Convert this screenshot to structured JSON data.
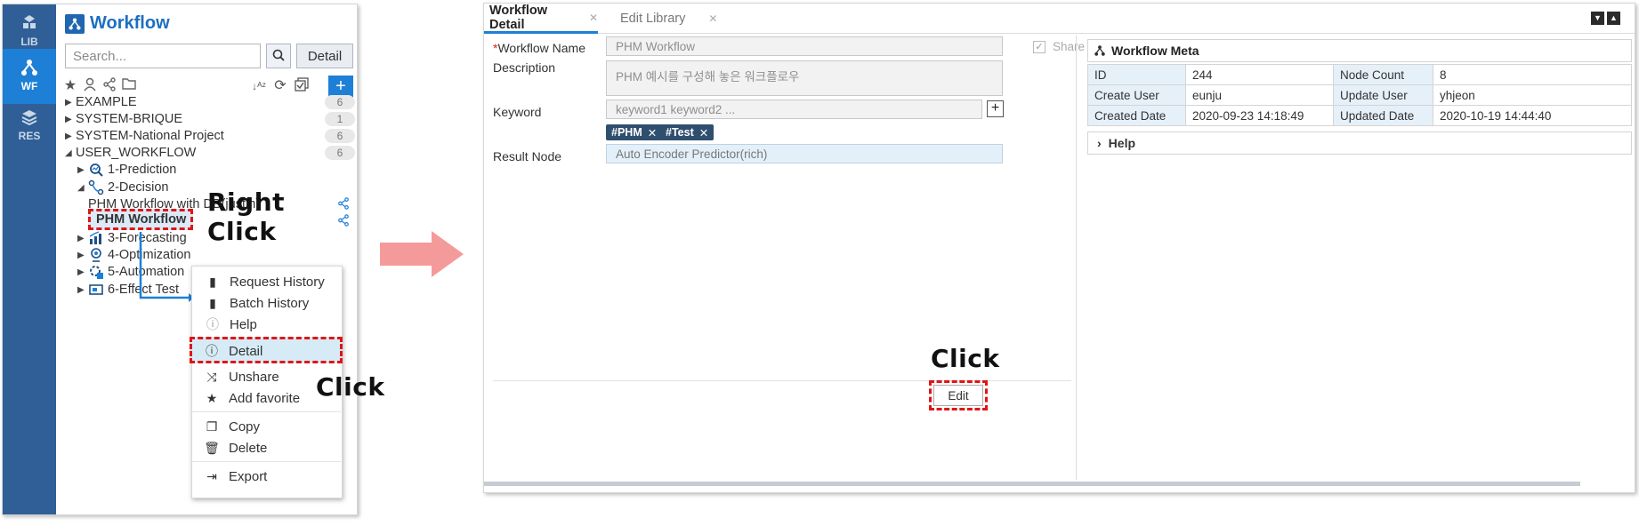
{
  "left": {
    "rail": [
      {
        "label": "LIB",
        "icon": "layers-icon",
        "active": false
      },
      {
        "label": "WF",
        "icon": "workflow-icon",
        "active": true
      },
      {
        "label": "RES",
        "icon": "stack-icon",
        "active": false
      }
    ],
    "title": "Workflow",
    "search": {
      "placeholder": "Search...",
      "value": ""
    },
    "detail_button": "Detail",
    "toolbar_icons": [
      "star-icon",
      "user-icon",
      "share-icon",
      "folder-icon",
      "sort-az-icon",
      "refresh-icon",
      "check-all-icon",
      "add-icon"
    ],
    "add_label": "+",
    "tree": {
      "roots": [
        {
          "label": "EXAMPLE",
          "count": "6"
        },
        {
          "label": "SYSTEM-BRIQUE",
          "count": "1"
        },
        {
          "label": "SYSTEM-National Project",
          "count": "6"
        },
        {
          "label": "USER_WORKFLOW",
          "count": "6"
        }
      ],
      "children": [
        {
          "label": "1-Prediction",
          "icon": "prediction-icon"
        },
        {
          "label": "2-Decision",
          "icon": "decision-icon"
        },
        {
          "label": "3-Forecasting",
          "icon": "chart-icon"
        },
        {
          "label": "4-Optimization",
          "icon": "optimization-icon"
        },
        {
          "label": "5-Automation",
          "icon": "automation-icon"
        },
        {
          "label": "6-Effect Test",
          "icon": "effect-test-icon"
        }
      ],
      "leaf_shared": "PHM Workflow with DB(justin)",
      "leaf_selected": "PHM Workflow"
    },
    "context_menu": [
      {
        "label": "Request History",
        "icon": "document-icon"
      },
      {
        "label": "Batch History",
        "icon": "document-icon"
      },
      {
        "label": "Help",
        "icon": "help-icon"
      },
      {
        "label": "Detail",
        "icon": "info-icon"
      },
      {
        "label": "Unshare",
        "icon": "unshare-icon"
      },
      {
        "label": "Add favorite",
        "icon": "star-icon"
      },
      {
        "label": "Copy",
        "icon": "copy-icon"
      },
      {
        "label": "Delete",
        "icon": "trash-icon"
      },
      {
        "label": "Export",
        "icon": "export-icon"
      }
    ],
    "callouts": {
      "right_click": "Right Click",
      "click": "Click"
    }
  },
  "right": {
    "tabs": [
      {
        "label": "Workflow Detail",
        "active": true
      },
      {
        "label": "Edit Library",
        "active": false
      }
    ],
    "form": {
      "name_label": "Workflow Name",
      "name_required_mark": "*",
      "name_value": "PHM Workflow",
      "share_label": "Share",
      "share_checked": true,
      "description_label": "Description",
      "description_value": "PHM 예시를 구성해 놓은 워크플로우",
      "keyword_label": "Keyword",
      "keyword_placeholder": "keyword1 keyword2 ...",
      "keyword_add": "+",
      "keywords": [
        "#PHM",
        "#Test"
      ],
      "result_label": "Result Node",
      "result_value": "Auto Encoder Predictor(rich)"
    },
    "meta": {
      "title": "Workflow Meta",
      "rows": [
        {
          "k1": "ID",
          "v1": "244",
          "k2": "Node Count",
          "v2": "8"
        },
        {
          "k1": "Create User",
          "v1": "eunju",
          "k2": "Update User",
          "v2": "yhjeon"
        },
        {
          "k1": "Created Date",
          "v1": "2020-09-23 14:18:49",
          "k2": "Updated Date",
          "v2": "2020-10-19 14:44:40"
        }
      ],
      "help_label": "Help"
    },
    "edit_button": "Edit",
    "callout_click": "Click"
  },
  "colors": {
    "accent": "#1d7fd6",
    "rail": "#2f5f96",
    "highlight": "#e01515",
    "arrow": "#f59a9a"
  }
}
